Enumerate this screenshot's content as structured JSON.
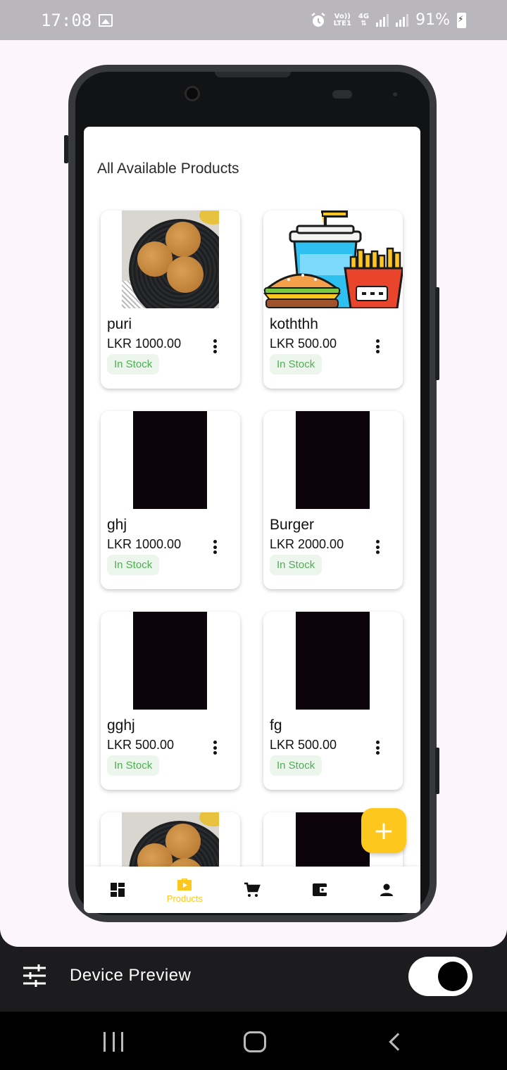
{
  "status_bar": {
    "time": "17:08",
    "net_top": "Vo))",
    "net_bottom": "LTE1",
    "net_type": "4G",
    "battery": "91%",
    "icons": [
      "gallery-icon",
      "alarm-icon",
      "signal-icon",
      "signal-icon",
      "battery-charging-icon"
    ]
  },
  "app": {
    "title": "All Available Products",
    "products": [
      {
        "name": "puri",
        "price": "LKR 1000.00",
        "stock": "In Stock",
        "image": "puri"
      },
      {
        "name": "koththh",
        "price": "LKR 500.00",
        "stock": "In Stock",
        "image": "combo"
      },
      {
        "name": "ghj",
        "price": "LKR 1000.00",
        "stock": "In Stock",
        "image": "dark"
      },
      {
        "name": "Burger",
        "price": "LKR 2000.00",
        "stock": "In Stock",
        "image": "dark"
      },
      {
        "name": "gghj",
        "price": "LKR 500.00",
        "stock": "In Stock",
        "image": "dark"
      },
      {
        "name": "fg",
        "price": "LKR 500.00",
        "stock": "In Stock",
        "image": "dark"
      },
      {
        "name": "",
        "price": "",
        "stock": "",
        "image": "puri"
      },
      {
        "name": "",
        "price": "",
        "stock": "",
        "image": "dark"
      }
    ],
    "fab_label": "+",
    "nav": {
      "items": [
        {
          "id": "dashboard",
          "label": "",
          "icon": "dashboard-icon"
        },
        {
          "id": "products",
          "label": "Products",
          "icon": "products-icon",
          "active": true
        },
        {
          "id": "cart",
          "label": "",
          "icon": "cart-icon"
        },
        {
          "id": "wallet",
          "label": "",
          "icon": "wallet-icon"
        },
        {
          "id": "profile",
          "label": "",
          "icon": "profile-icon"
        }
      ],
      "active_color": "#fec71d"
    }
  },
  "device_preview": {
    "label": "Device Preview",
    "toggle_on": true
  },
  "colors": {
    "accent": "#fec71d",
    "stock_green": "#4caf50",
    "preview_bg": "#fcf5fc"
  }
}
